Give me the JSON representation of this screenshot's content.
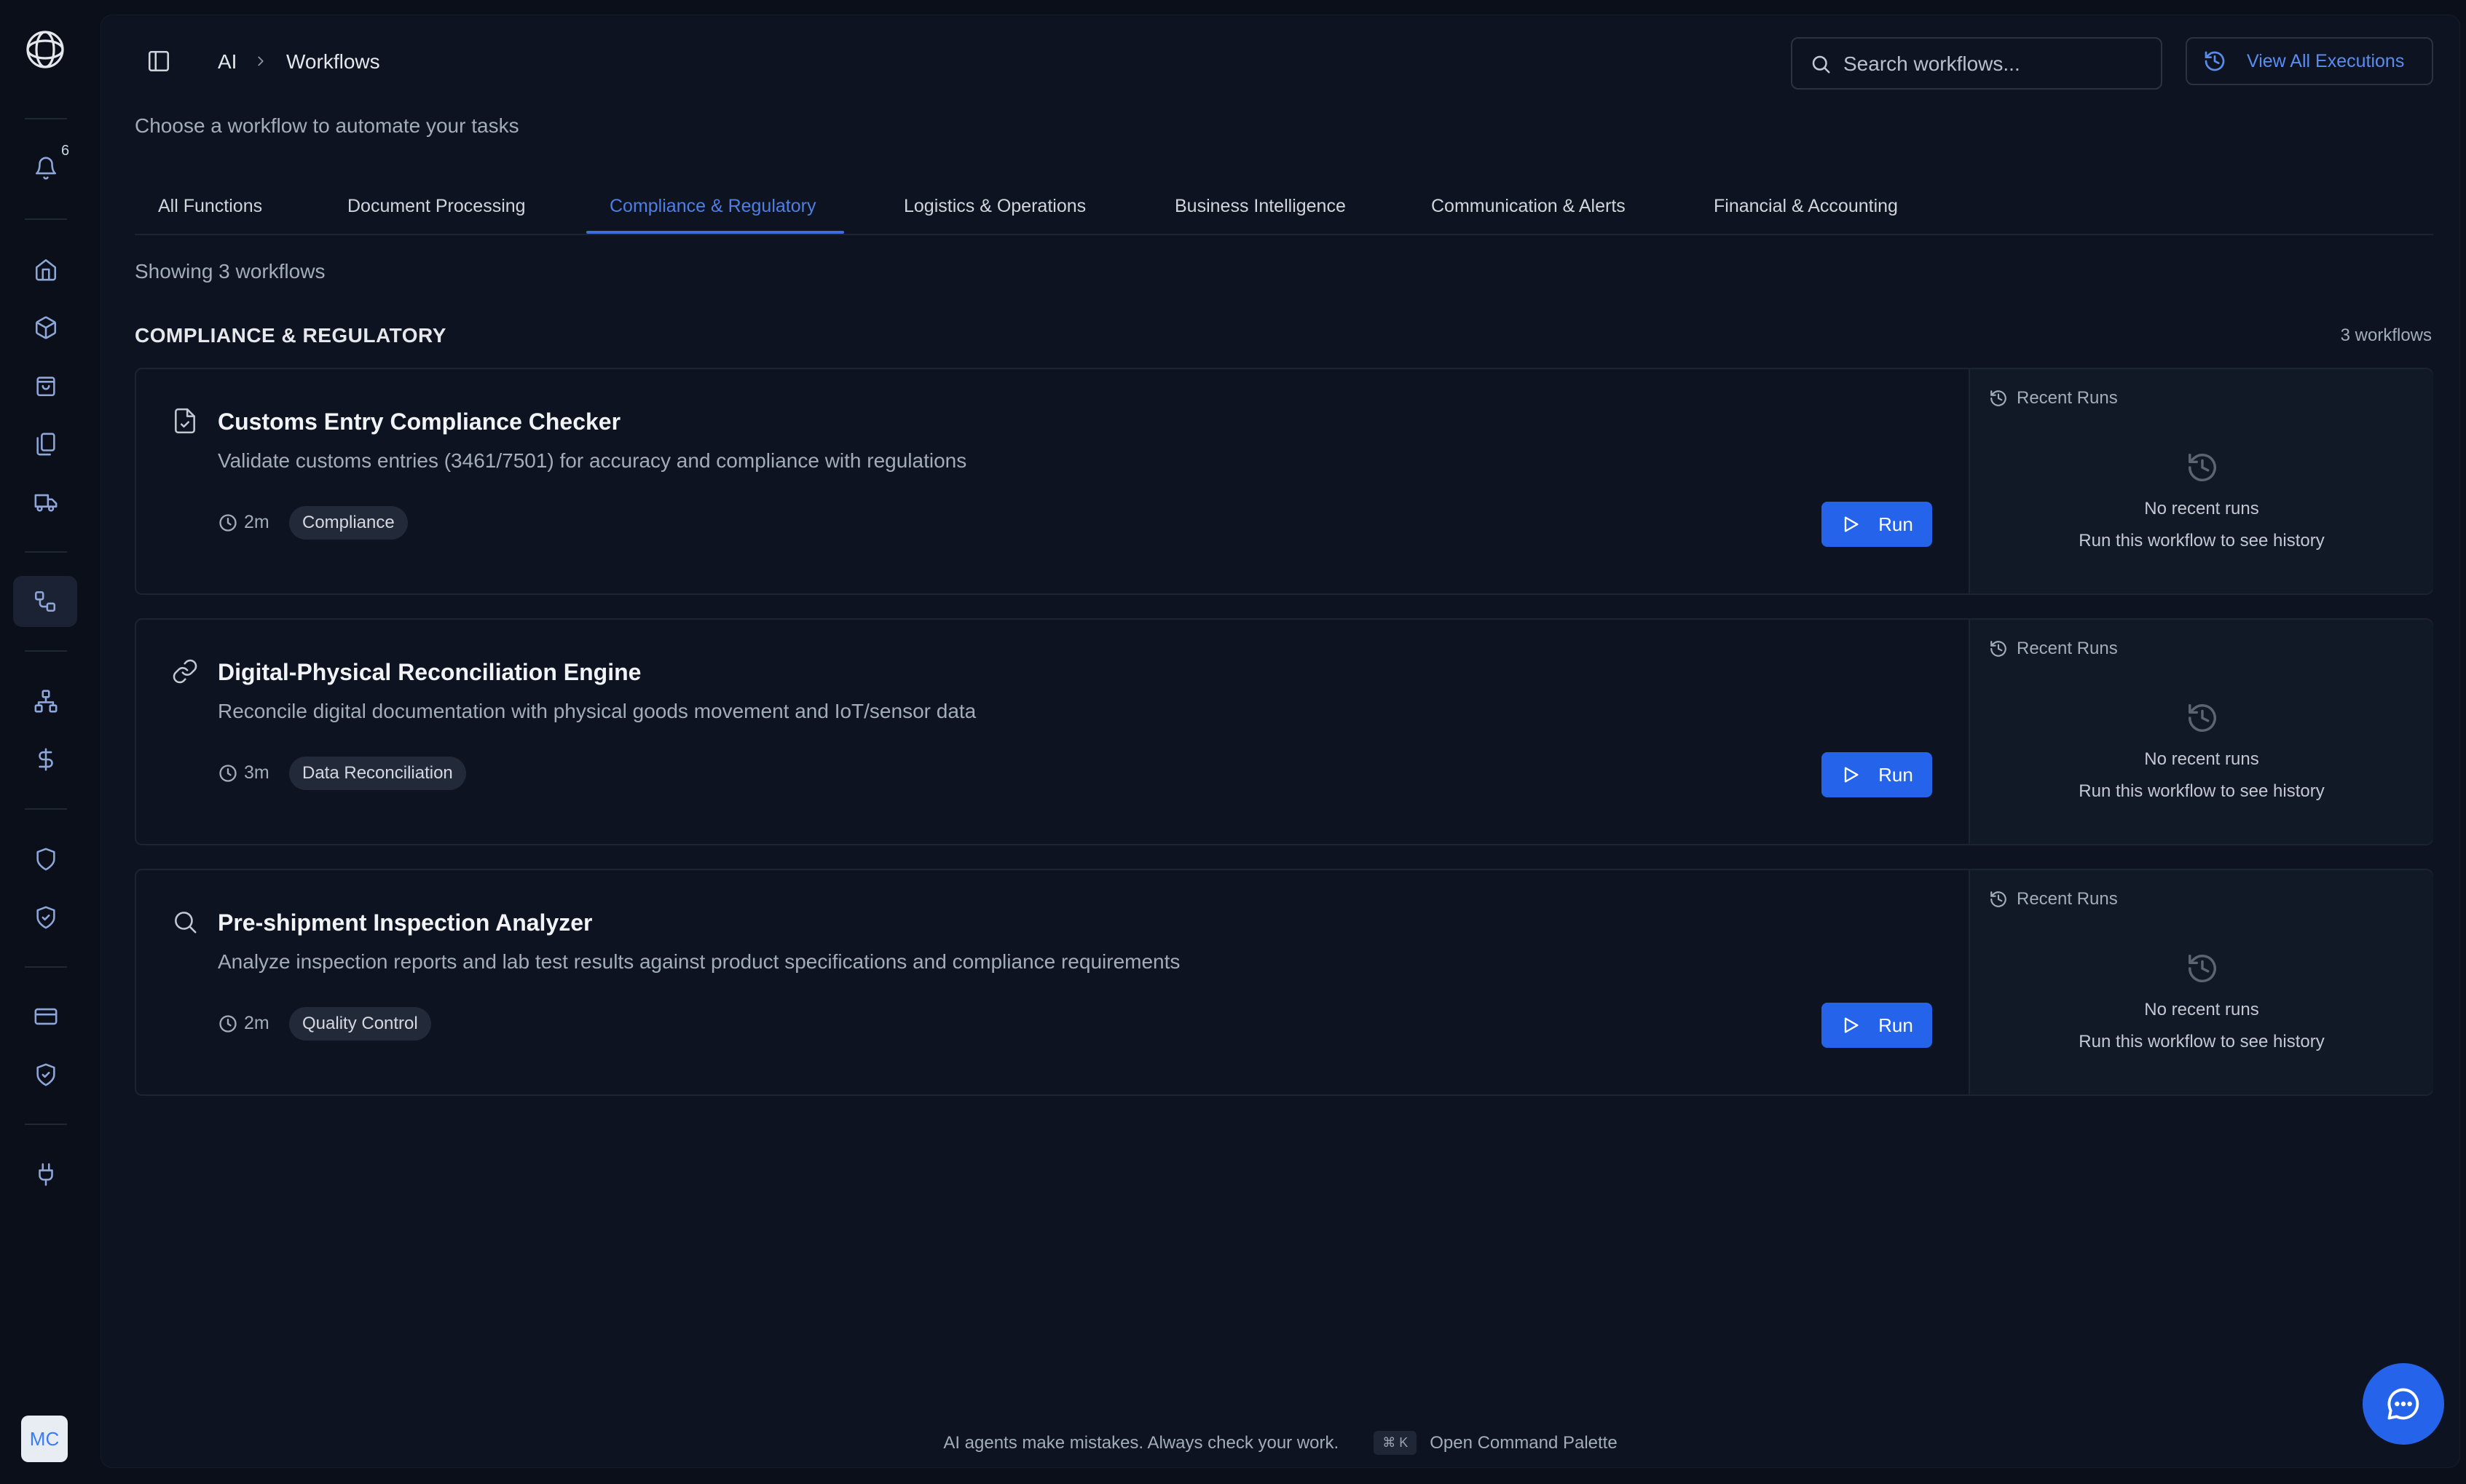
{
  "sidebar": {
    "notification_count": "6",
    "avatar_initials": "MC"
  },
  "header": {
    "breadcrumb_root": "AI",
    "breadcrumb_current": "Workflows",
    "search_placeholder": "Search workflows...",
    "view_all_label": "View All Executions"
  },
  "subtitle": "Choose a workflow to automate your tasks",
  "tabs": [
    {
      "label": "All Functions",
      "active": false
    },
    {
      "label": "Document Processing",
      "active": false
    },
    {
      "label": "Compliance & Regulatory",
      "active": true
    },
    {
      "label": "Logistics & Operations",
      "active": false
    },
    {
      "label": "Business Intelligence",
      "active": false
    },
    {
      "label": "Communication & Alerts",
      "active": false
    },
    {
      "label": "Financial & Accounting",
      "active": false
    }
  ],
  "showing_text": "Showing 3 workflows",
  "section": {
    "title": "COMPLIANCE & REGULATORY",
    "count": "3 workflows"
  },
  "workflows": [
    {
      "icon": "file-check-icon",
      "title": "Customs Entry Compliance Checker",
      "description": "Validate customs entries (3461/7501) for accuracy and compliance with regulations",
      "duration": "2m",
      "tag": "Compliance",
      "run_label": "Run",
      "recent_runs_label": "Recent Runs",
      "no_runs": "No recent runs",
      "no_runs_hint": "Run this workflow to see history"
    },
    {
      "icon": "link-icon",
      "title": "Digital-Physical Reconciliation Engine",
      "description": "Reconcile digital documentation with physical goods movement and IoT/sensor data",
      "duration": "3m",
      "tag": "Data Reconciliation",
      "run_label": "Run",
      "recent_runs_label": "Recent Runs",
      "no_runs": "No recent runs",
      "no_runs_hint": "Run this workflow to see history"
    },
    {
      "icon": "search-icon",
      "title": "Pre-shipment Inspection Analyzer",
      "description": "Analyze inspection reports and lab test results against product specifications and compliance requirements",
      "duration": "2m",
      "tag": "Quality Control",
      "run_label": "Run",
      "recent_runs_label": "Recent Runs",
      "no_runs": "No recent runs",
      "no_runs_hint": "Run this workflow to see history"
    }
  ],
  "footer": {
    "disclaimer": "AI agents make mistakes. Always check your work.",
    "shortcut": "⌘ K",
    "command_palette": "Open Command Palette"
  },
  "colors": {
    "accent": "#2563eb",
    "active_tab": "#4d7fe6",
    "background": "#0a0f1a",
    "panel": "#0d1320"
  }
}
